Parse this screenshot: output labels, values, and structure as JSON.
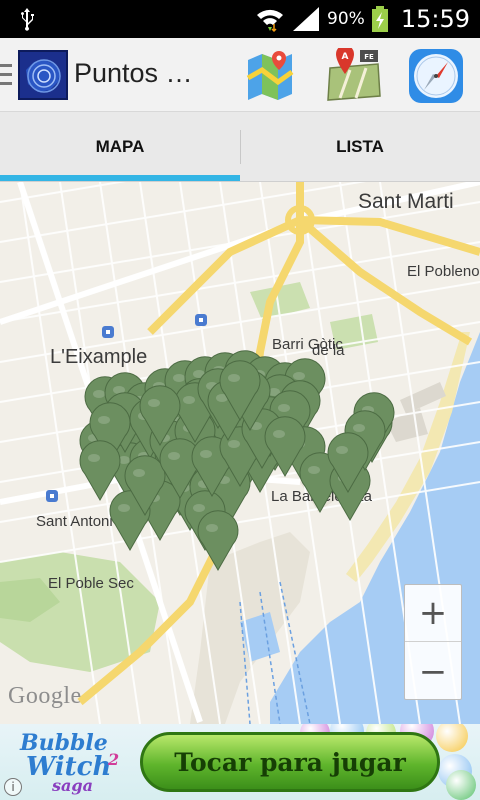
{
  "status_bar": {
    "battery_percent": "90%",
    "time": "15:59",
    "icons": [
      "usb-icon",
      "wifi-icon",
      "signal-icon",
      "battery-charging-icon"
    ]
  },
  "action_bar": {
    "title": "Puntos …",
    "icons": [
      "app-logo-icon",
      "map-icon",
      "navigation-icon",
      "compass-icon"
    ]
  },
  "tabs": [
    {
      "label": "MAPA",
      "selected": true
    },
    {
      "label": "LISTA",
      "selected": false
    }
  ],
  "map": {
    "labels": {
      "sant_marti": "Sant Marti",
      "el_poblenou": "El Poblenou",
      "eixample": "L'Eixample",
      "barri_gotic": "Barri Gòtic",
      "la_ribera": "de la",
      "la_barceloneta": "La Barceloneta",
      "sant_antoni": "Sant Antoni",
      "el_poble_sec": "El Poble Sec"
    },
    "zoom_in_label": "+",
    "zoom_out_label": "−",
    "attribution": "Google",
    "marker_color": "#6c8f60",
    "marker_count": 72
  },
  "ad": {
    "brand_line1": "Bubble",
    "brand_line2": "Witch",
    "brand_number": "2",
    "brand_line3": "saga",
    "cta_label": "Tocar para jugar",
    "info_label": "i"
  }
}
